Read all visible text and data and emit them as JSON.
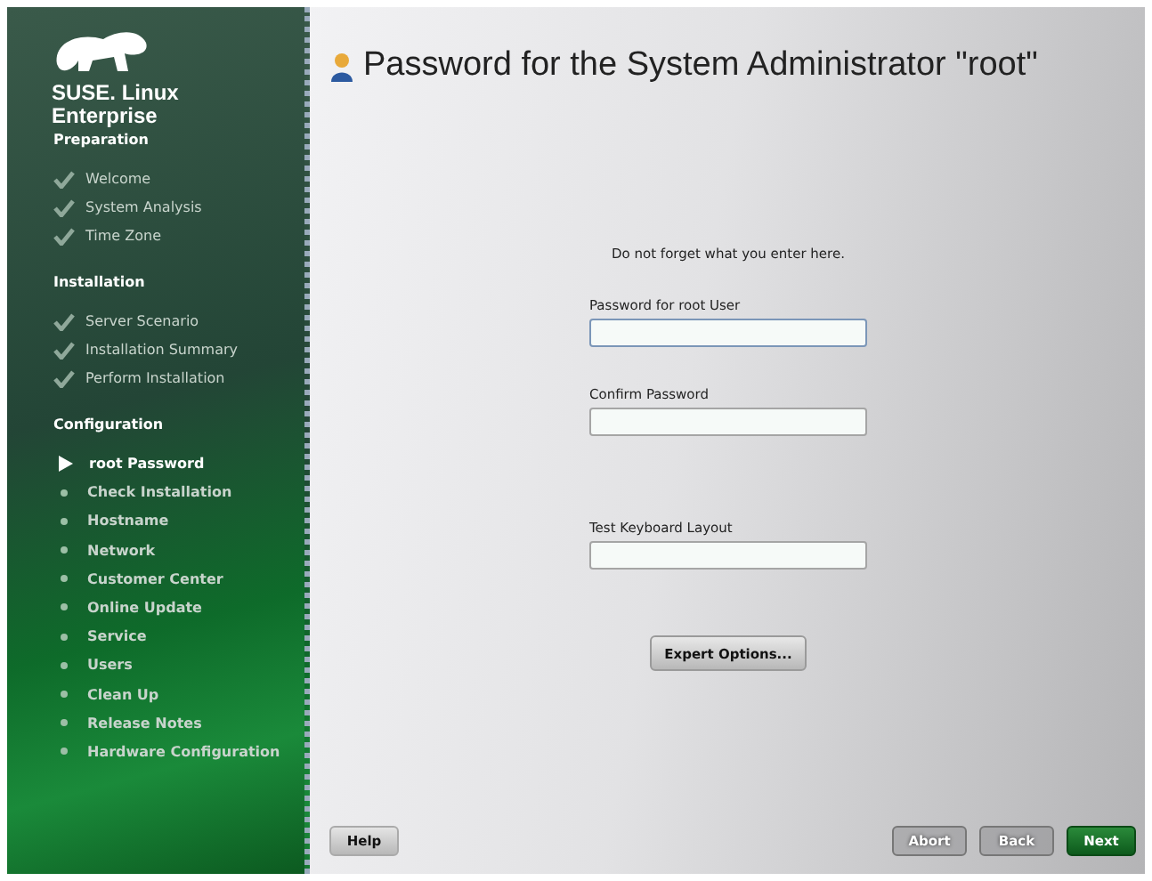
{
  "sidebar": {
    "brand": [
      "SUSE. Linux",
      "Enterprise"
    ],
    "sections": [
      {
        "title": "Preparation",
        "steps": [
          {
            "label": "Welcome",
            "kind": "done"
          },
          {
            "label": "System Analysis",
            "kind": "done"
          },
          {
            "label": "Time Zone",
            "kind": "done"
          }
        ]
      },
      {
        "title": "Installation",
        "steps": [
          {
            "label": "Server Scenario",
            "kind": "done"
          },
          {
            "label": "Installation Summary",
            "kind": "done"
          },
          {
            "label": "Perform Installation",
            "kind": "done"
          }
        ]
      },
      {
        "title": "Configuration",
        "steps": [
          {
            "label": "root Password",
            "kind": "current"
          },
          {
            "label": "Check Installation",
            "kind": "pending"
          },
          {
            "label": "Hostname",
            "kind": "pending"
          },
          {
            "label": "Network",
            "kind": "pending"
          },
          {
            "label": "Customer Center",
            "kind": "pending"
          },
          {
            "label": "Online Update",
            "kind": "pending"
          },
          {
            "label": "Service",
            "kind": "pending"
          },
          {
            "label": "Users",
            "kind": "pending"
          },
          {
            "label": "Clean Up",
            "kind": "pending"
          },
          {
            "label": "Release Notes",
            "kind": "pending"
          },
          {
            "label": "Hardware Configuration",
            "kind": "pending"
          }
        ]
      }
    ]
  },
  "title": "Password for the System Administrator \"root\"",
  "note": "Do not forget what you enter here.",
  "fields": [
    {
      "label": "Password for root User",
      "focused": true
    },
    {
      "label": "Confirm Password",
      "focused": false
    },
    {
      "label": "Test Keyboard Layout",
      "focused": false
    }
  ],
  "expert_button": "Expert Options...",
  "buttons": [
    {
      "label": "Help",
      "kind": "plain"
    },
    {
      "label": "Abort",
      "kind": "outline"
    },
    {
      "label": "Back",
      "kind": "outline"
    },
    {
      "label": "Next",
      "kind": "primary"
    }
  ]
}
